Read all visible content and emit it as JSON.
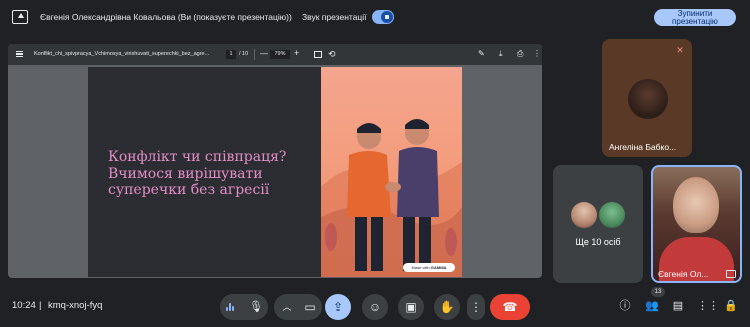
{
  "topbar": {
    "presenting_title": "Євгенія Олександрівна Ковальова (Ви (показуєте презентацію))",
    "sound_label": "Звук презентації",
    "sound_enabled": true,
    "stop_button_line1": "Зупинити",
    "stop_button_line2": "презентацію"
  },
  "pdf_viewer": {
    "file_name": "Konflikt_chi_spivpracya_Vchimosya_virishuvati_superechki_bez_agre...",
    "current_page": "1",
    "total_pages": "/ 10",
    "zoom": "79%",
    "toolbar_icons": [
      "menu-icon",
      "fit-page-icon",
      "rotate-icon",
      "pen-icon",
      "download-icon",
      "print-icon",
      "more-vert-icon"
    ]
  },
  "slide": {
    "title_line1": "Конфлікт чи співпраця?",
    "title_line2": "Вчимося вирішувати",
    "title_line3": "суперечки без агресії",
    "made_with_prefix": "Made with",
    "made_with_brand": "GAMMA",
    "accent_color": "#e48ec7"
  },
  "participants": {
    "tile_a_name": "Ангеліна Бабко...",
    "tile_a_muted": true,
    "tile_b_more": "Ще 10 осіб",
    "tile_c_name": "Євгенія Ол..."
  },
  "bottombar": {
    "time": "10:24",
    "separator": "|",
    "meeting_code": "kmq-xnoj-fyq",
    "people_count": "13"
  },
  "colors": {
    "background": "#202124",
    "end_call": "#ea4335",
    "active_button": "#a8c7fa"
  }
}
